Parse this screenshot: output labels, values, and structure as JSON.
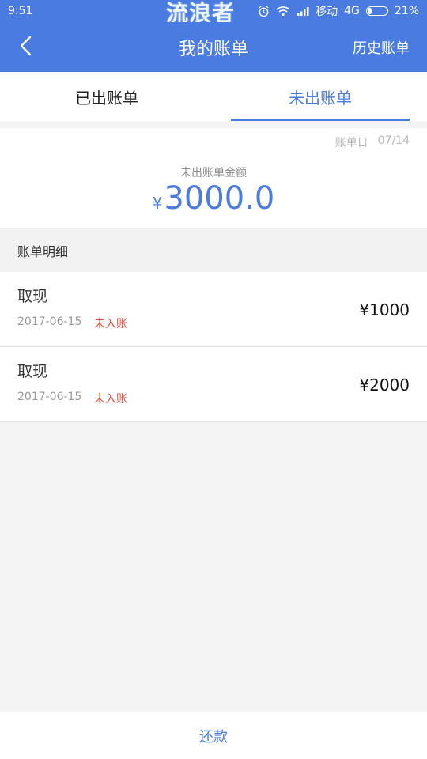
{
  "status_bar": {
    "time": "9:51",
    "watermark": "流浪者",
    "carrier": "移动",
    "network": "4G",
    "battery": "21%",
    "battery_level": 0.21,
    "icons": [
      "alarm-icon",
      "wifi-icon",
      "signal-icon",
      "battery-icon"
    ]
  },
  "nav": {
    "back_icon": "chevron-left-icon",
    "title": "我的账单",
    "history": "历史账单"
  },
  "tabs": [
    {
      "label": "已出账单",
      "active": false
    },
    {
      "label": "未出账单",
      "active": true
    }
  ],
  "summary": {
    "bill_day_label": "账单日",
    "bill_day": "07/14",
    "amount_label": "未出账单金额",
    "currency": "¥",
    "amount": "3000.0"
  },
  "detail_header": "账单明细",
  "items": [
    {
      "title": "取现",
      "date": "2017-06-15",
      "status": "未入账",
      "amount": "¥1000"
    },
    {
      "title": "取现",
      "date": "2017-06-15",
      "status": "未入账",
      "amount": "¥2000"
    }
  ],
  "bottom": {
    "repay": "还款"
  },
  "colors": {
    "primary": "#4a7be0",
    "status_red": "#e0473b"
  }
}
